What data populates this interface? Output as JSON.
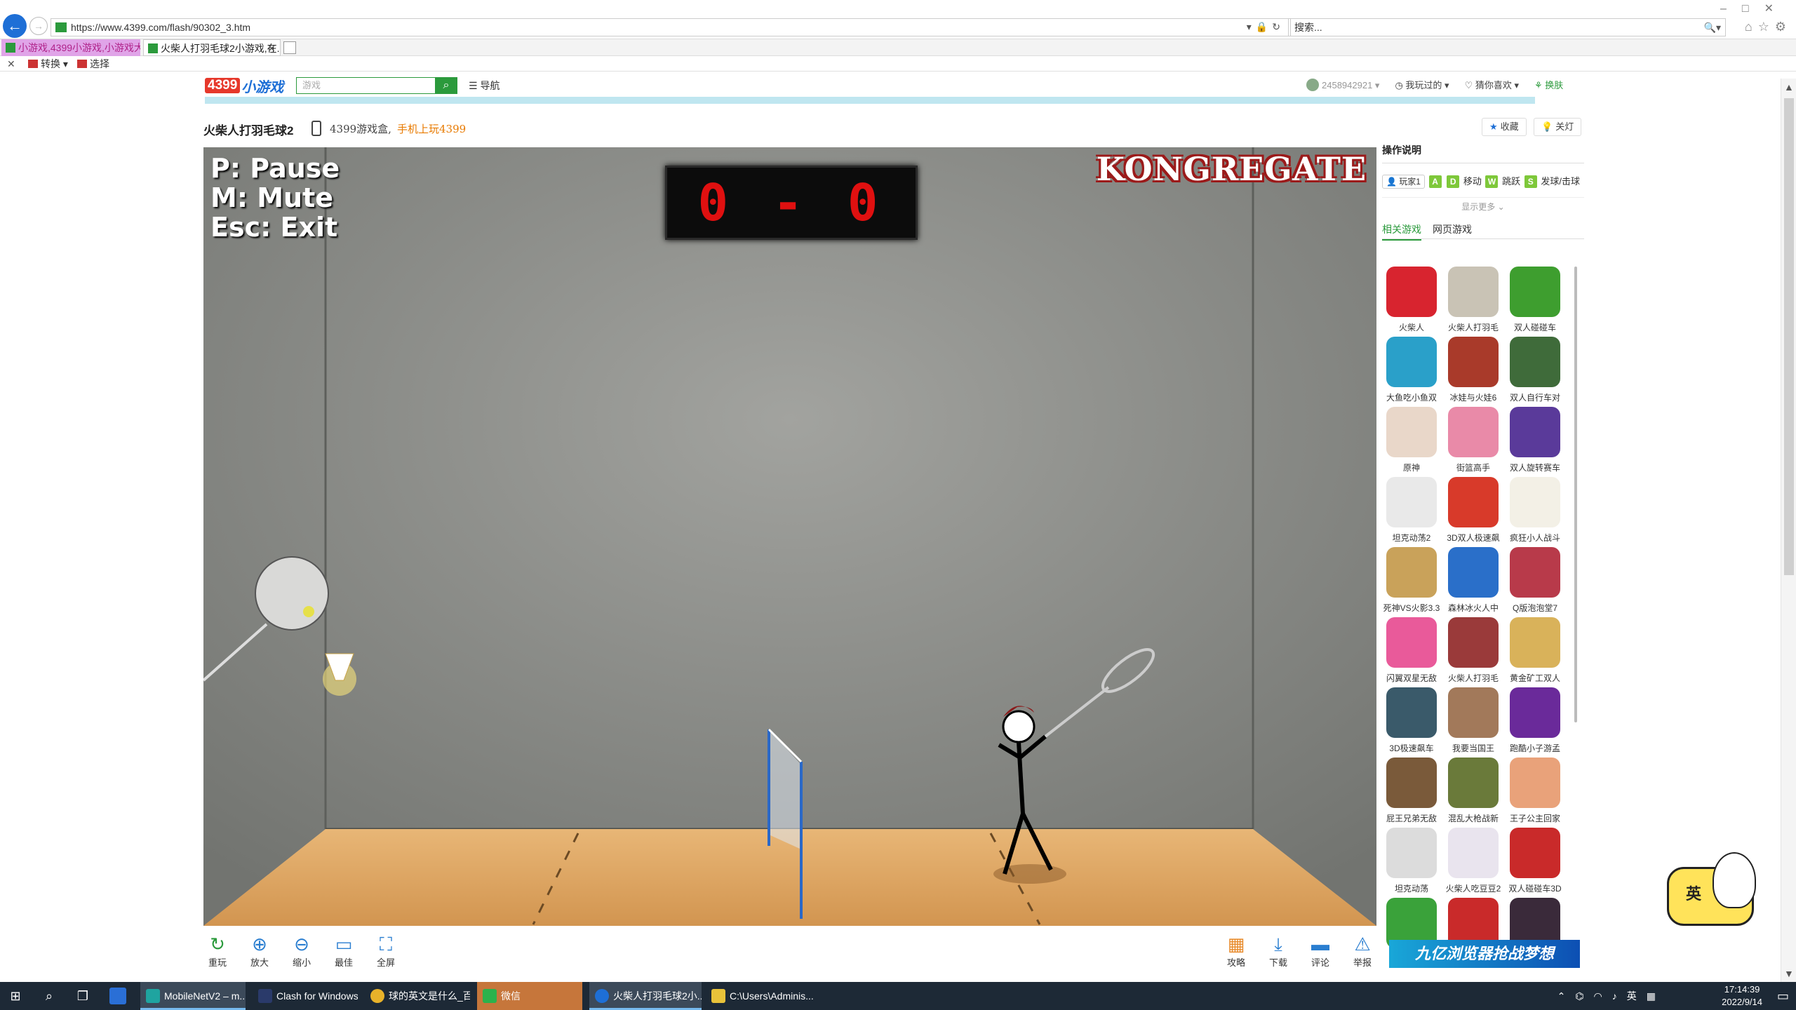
{
  "browser": {
    "url": "https://www.4399.com/flash/90302_3.htm",
    "search_placeholder": "搜索...",
    "tabs": [
      {
        "label": "小游戏,4399小游戏,小游戏大..."
      },
      {
        "label": "火柴人打羽毛球2小游戏,在..."
      }
    ],
    "command_bar": {
      "convert": "转换",
      "select": "选择"
    }
  },
  "site": {
    "logo_num": "4399",
    "logo_text": "小游戏",
    "search_placeholder": "游戏",
    "nav": "导航",
    "user_id": "2458942921",
    "played": "我玩过的",
    "likes": "猜你喜欢",
    "skin": "换肤"
  },
  "game_header": {
    "title": "火柴人打羽毛球2",
    "promo_a": "4399游戏盒,",
    "promo_b": "手机上玩4399",
    "favorite": "收藏",
    "lights_off": "关灯"
  },
  "game": {
    "help": [
      "P: Pause",
      "M: Mute",
      "Esc: Exit"
    ],
    "score": "0 - 0",
    "brand": "KONGREGATE"
  },
  "toolbar_left": [
    {
      "icon": "refresh-icon",
      "label": "重玩"
    },
    {
      "icon": "zoom-in-icon",
      "label": "放大"
    },
    {
      "icon": "zoom-out-icon",
      "label": "缩小"
    },
    {
      "icon": "best-fit-icon",
      "label": "最佳"
    },
    {
      "icon": "fullscreen-icon",
      "label": "全屏"
    }
  ],
  "toolbar_right": [
    {
      "icon": "strategy-icon",
      "label": "攻略"
    },
    {
      "icon": "download-icon",
      "label": "下载"
    },
    {
      "icon": "comment-icon",
      "label": "评论"
    },
    {
      "icon": "report-icon",
      "label": "举报"
    }
  ],
  "sidebar": {
    "title": "操作说明",
    "player": "玩家1",
    "keys": {
      "left": "A",
      "right": "D",
      "move": "移动",
      "jump_key": "W",
      "jump": "跳跃",
      "serve_key": "S",
      "serve": "发球/击球"
    },
    "show_more": "显示更多",
    "tab_related": "相关游戏",
    "tab_web": "网页游戏",
    "games": [
      {
        "name": "火柴人",
        "color": "#d8242f"
      },
      {
        "name": "火柴人打羽毛",
        "color": "#c9c3b5"
      },
      {
        "name": "双人碰碰车",
        "color": "#3e9e2f"
      },
      {
        "name": "大鱼吃小鱼双",
        "color": "#2aa0c9"
      },
      {
        "name": "冰娃与火娃6",
        "color": "#a93a2a"
      },
      {
        "name": "双人自行车对",
        "color": "#3f6b3a"
      },
      {
        "name": "原神",
        "color": "#e9d7c9"
      },
      {
        "name": "街篮高手",
        "color": "#e98aa8"
      },
      {
        "name": "双人旋转赛车",
        "color": "#5a3a9a"
      },
      {
        "name": "坦克动荡2",
        "color": "#e9e9e9"
      },
      {
        "name": "3D双人极速飙",
        "color": "#d83a2a"
      },
      {
        "name": "疯狂小人战斗",
        "color": "#f3f0e6"
      },
      {
        "name": "死神VS火影3.3",
        "color": "#c9a25a"
      },
      {
        "name": "森林冰火人中",
        "color": "#2a6fc9"
      },
      {
        "name": "Q版泡泡堂7",
        "color": "#b83a4a"
      },
      {
        "name": "闪翼双星无敌",
        "color": "#e95a9a"
      },
      {
        "name": "火柴人打羽毛",
        "color": "#9a3a3a"
      },
      {
        "name": "黄金矿工双人",
        "color": "#d9b25a"
      },
      {
        "name": "3D极速飙车",
        "color": "#3a5a6a"
      },
      {
        "name": "我要当国王",
        "color": "#a2795a"
      },
      {
        "name": "跑酷小子游孟",
        "color": "#6a2a9a"
      },
      {
        "name": "屁王兄弟无敌",
        "color": "#7a5a3a"
      },
      {
        "name": "混乱大枪战新",
        "color": "#6a7a3a"
      },
      {
        "name": "王子公主回家",
        "color": "#e9a27a"
      },
      {
        "name": "坦克动荡",
        "color": "#dcdcdc"
      },
      {
        "name": "火柴人吃豆豆2",
        "color": "#e9e4ee"
      },
      {
        "name": "双人碰碰车3D",
        "color": "#c92a2a"
      },
      {
        "name": "",
        "color": "#3aa23a"
      },
      {
        "name": "",
        "color": "#c92a2a"
      },
      {
        "name": "",
        "color": "#3a2a3a"
      }
    ],
    "banner": "九亿浏览器抢战梦想"
  },
  "ime": "英",
  "taskbar": {
    "apps": [
      {
        "label": "MobileNetV2 – m...",
        "color": "#1fa4a0"
      },
      {
        "label": "Clash for Windows",
        "color": "#2a3a6a"
      },
      {
        "label": "球的英文是什么_百...",
        "color": "#e8b22a"
      },
      {
        "label": "微信",
        "color": "#2bb24c"
      },
      {
        "label": "火柴人打羽毛球2小...",
        "color": "#1e6fd6"
      },
      {
        "label": "C:\\Users\\Adminis...",
        "color": "#e8c23a"
      }
    ],
    "tray_lang": "英",
    "time": "17:14:39",
    "date": "2022/9/14"
  }
}
